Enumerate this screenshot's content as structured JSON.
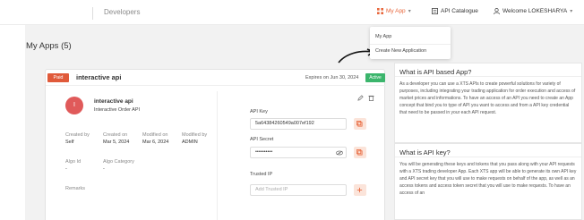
{
  "header": {
    "brand_text": "Developers",
    "nav_my_app": "My App",
    "nav_api_catalogue": "API Catalogue",
    "nav_user": "Welcome LOKESHARYA"
  },
  "dropdown": {
    "item1": "My App",
    "item2": "Create New Application"
  },
  "page": {
    "title": "My Apps (5)"
  },
  "app_card": {
    "paid_badge": "Paid",
    "name": "interactive api",
    "expires": "Expires on Jun 30, 2024",
    "status": "Active",
    "avatar_letter": "I",
    "title": "interactive api",
    "description": "Interactive Order API",
    "created_by_label": "Created by",
    "created_by_value": "Self",
    "created_on_label": "Created on",
    "created_on_value": "Mar 5, 2024",
    "modified_on_label": "Modified on",
    "modified_on_value": "Mar 6, 2024",
    "modified_by_label": "Modified by",
    "modified_by_value": "ADMIN",
    "algo_id_label": "Algo Id",
    "algo_id_value": "-",
    "algo_category_label": "Algo Category",
    "algo_category_value": "-",
    "remarks_label": "Remarks",
    "api_key_label": "API Key",
    "api_key_value": "5a64384260549a007ef192",
    "api_secret_label": "API Secret",
    "api_secret_value": "••••••••••",
    "trusted_ip_label": "Trusted IP",
    "trusted_ip_placeholder": "Add Trusted IP"
  },
  "info": {
    "q1_title": "What is API based App?",
    "q1_body": "As a developer you can use a XTS APIs to create powerful solutions for variety of purposes, including integrating your trading application for order execution and access of market prices and informations. To have an access of an API you need to create an App concept that bind you to type of API you want to access and from a API key credential that need to be passed in your each API request.",
    "q2_title": "What is API key?",
    "q2_body": "You will be generating these keys and tokens that you pass along with your API requests with a XTS trading developer App. Each XTS app will be able to generate its own API key and API secret key that you will use to make requests on behalf of the app, as well as an access tokens and access token secret that you will use to make requests. To have an access of an"
  },
  "colors": {
    "accent": "#e8673c",
    "paid": "#e05a3a",
    "active": "#3bb56c"
  }
}
